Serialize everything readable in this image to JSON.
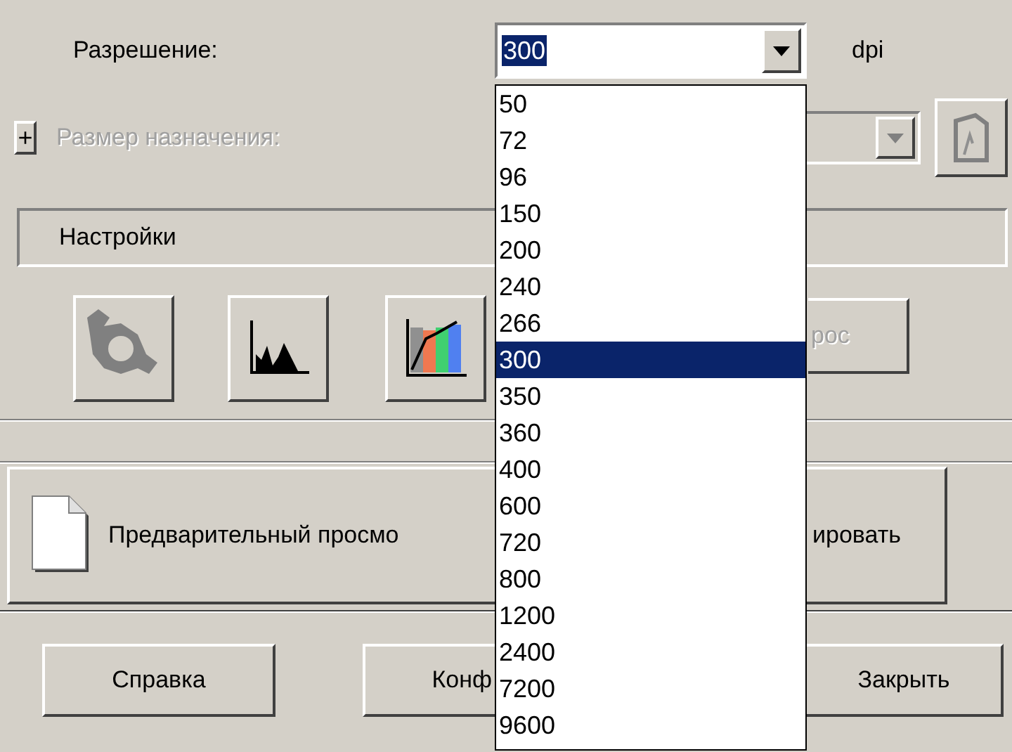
{
  "resolution": {
    "label": "Разрешение:",
    "value": "300",
    "unit": "dpi",
    "open": true,
    "options": [
      {
        "label": "50",
        "selected": false
      },
      {
        "label": "72",
        "selected": false
      },
      {
        "label": "96",
        "selected": false
      },
      {
        "label": "150",
        "selected": false
      },
      {
        "label": "200",
        "selected": false
      },
      {
        "label": "240",
        "selected": false
      },
      {
        "label": "266",
        "selected": false
      },
      {
        "label": "300",
        "selected": true
      },
      {
        "label": "350",
        "selected": false
      },
      {
        "label": "360",
        "selected": false
      },
      {
        "label": "400",
        "selected": false
      },
      {
        "label": "600",
        "selected": false
      },
      {
        "label": "720",
        "selected": false
      },
      {
        "label": "800",
        "selected": false
      },
      {
        "label": "1200",
        "selected": false
      },
      {
        "label": "2400",
        "selected": false
      },
      {
        "label": "7200",
        "selected": false
      },
      {
        "label": "9600",
        "selected": false
      }
    ]
  },
  "target_size": {
    "expand": "+",
    "label": "Размер назначения:",
    "disabled": true
  },
  "settings": {
    "label": "Настройки"
  },
  "reset_button": {
    "label": "рос",
    "disabled": true
  },
  "preview_button": {
    "label": "Предварительный просмо"
  },
  "scan_button": {
    "label": "ировать"
  },
  "buttons": [
    {
      "label": "Справка"
    },
    {
      "label": "Конф"
    },
    {
      "label": "Закрыть"
    }
  ]
}
